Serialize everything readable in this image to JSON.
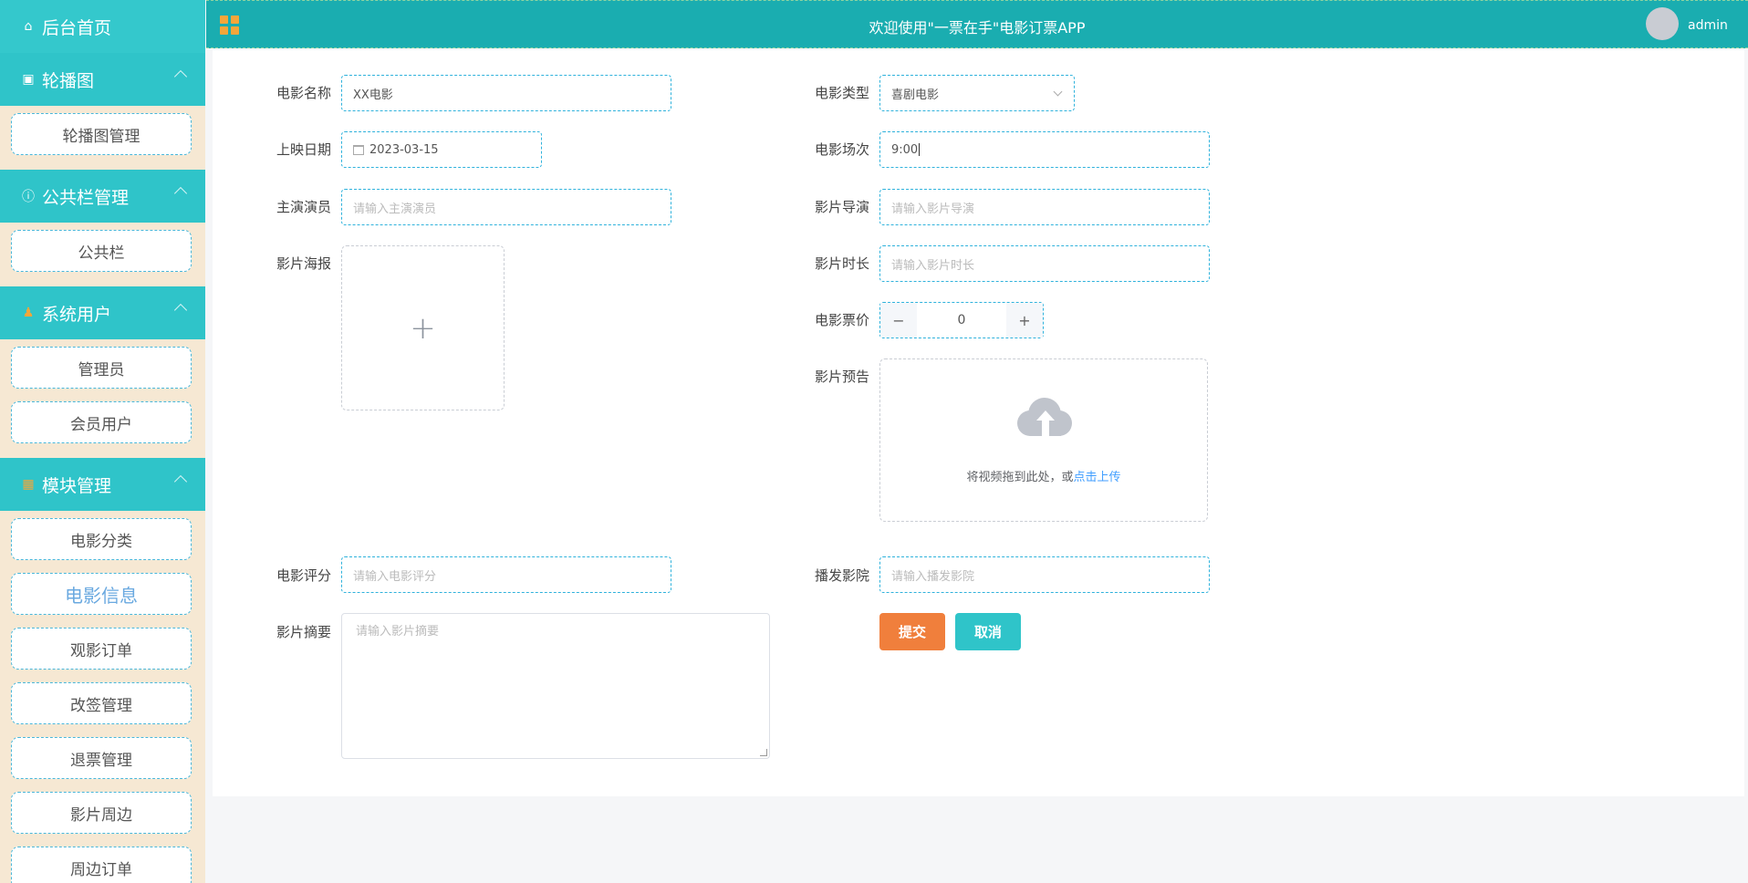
{
  "header": {
    "title": "欢迎使用\"一票在手\"电影订票APP",
    "username": "admin"
  },
  "sidebar": {
    "home": "后台首页",
    "groups": [
      {
        "label": "轮播图",
        "icon": "image-icon",
        "items": [
          "轮播图管理"
        ]
      },
      {
        "label": "公共栏管理",
        "icon": "info-icon",
        "items": [
          "公共栏"
        ]
      },
      {
        "label": "系统用户",
        "icon": "user-icon",
        "items": [
          "管理员",
          "会员用户"
        ]
      },
      {
        "label": "模块管理",
        "icon": "grid-icon",
        "items": [
          "电影分类",
          "电影信息",
          "观影订单",
          "改签管理",
          "退票管理",
          "影片周边",
          "周边订单"
        ]
      }
    ],
    "active_item": "电影信息"
  },
  "form": {
    "name": {
      "label": "电影名称",
      "value": "XX电影"
    },
    "type": {
      "label": "电影类型",
      "value": "喜剧电影"
    },
    "date": {
      "label": "上映日期",
      "value": "2023-03-15"
    },
    "session": {
      "label": "电影场次",
      "value": "9:00"
    },
    "actors": {
      "label": "主演演员",
      "placeholder": "请输入主演演员"
    },
    "director": {
      "label": "影片导演",
      "placeholder": "请输入影片导演"
    },
    "poster": {
      "label": "影片海报"
    },
    "duration": {
      "label": "影片时长",
      "placeholder": "请输入影片时长"
    },
    "price": {
      "label": "电影票价",
      "value": "0",
      "minus": "−",
      "plus": "+"
    },
    "trailer": {
      "label": "影片预告",
      "hint": "将视频拖到此处，或",
      "link": "点击上传"
    },
    "rating": {
      "label": "电影评分",
      "placeholder": "请输入电影评分"
    },
    "cinema": {
      "label": "播发影院",
      "placeholder": "请输入播发影院"
    },
    "summary": {
      "label": "影片摘要",
      "placeholder": "请输入影片摘要"
    },
    "submit": "提交",
    "cancel": "取消"
  }
}
